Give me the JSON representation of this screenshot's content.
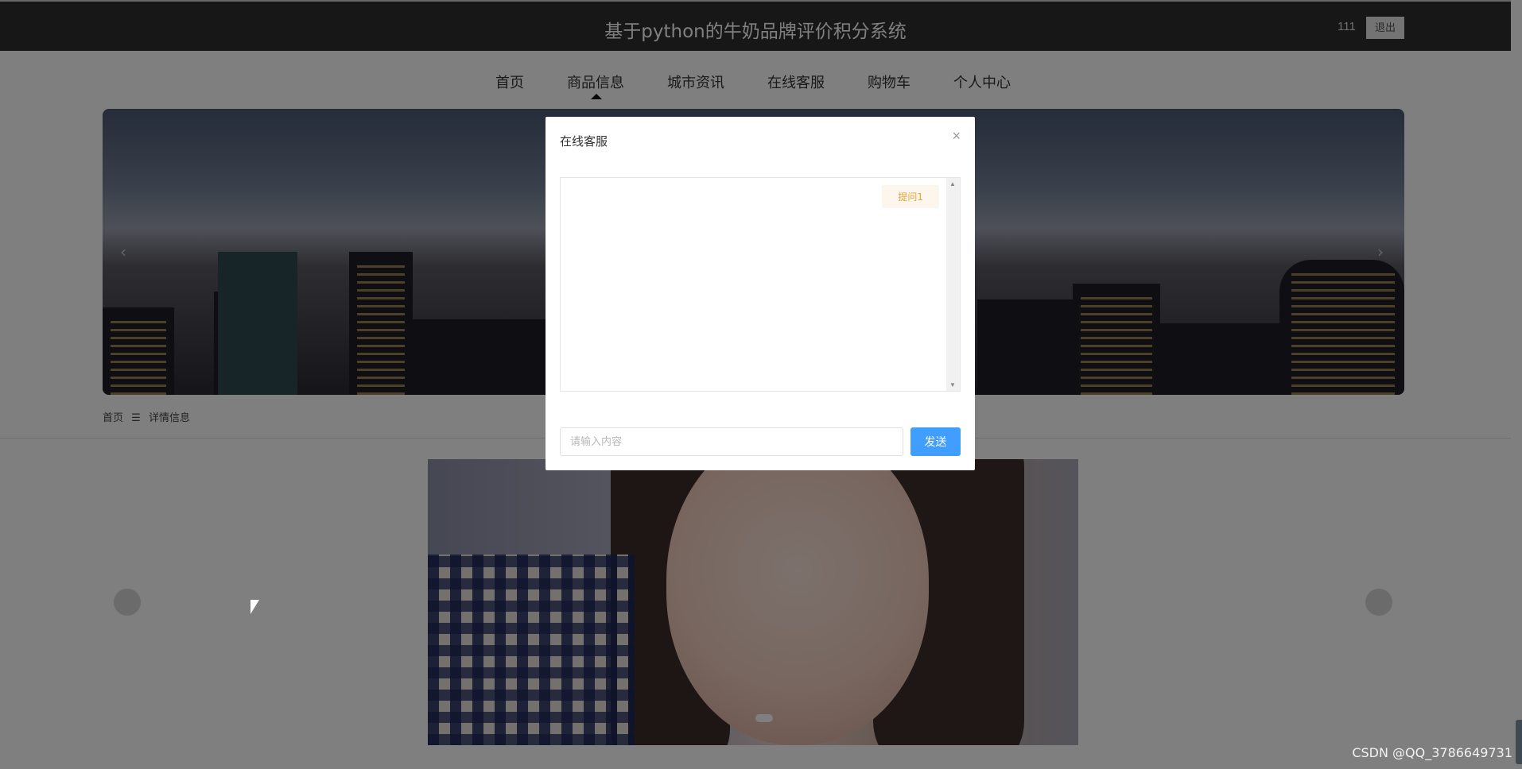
{
  "header": {
    "title": "基于python的牛奶品牌评价积分系统",
    "user": "111",
    "logout_label": "退出"
  },
  "nav": {
    "items": [
      {
        "label": "首页"
      },
      {
        "label": "商品信息"
      },
      {
        "label": "城市资讯"
      },
      {
        "label": "在线客服"
      },
      {
        "label": "购物车"
      },
      {
        "label": "个人中心"
      }
    ],
    "active_index": 1
  },
  "banner": {
    "prev_icon": "chevron-left-icon",
    "next_icon": "chevron-right-icon"
  },
  "breadcrumb": {
    "home": "首页",
    "separator": "☰",
    "current": "详情信息"
  },
  "modal": {
    "title": "在线客服",
    "close_icon": "close-icon",
    "messages": [
      {
        "text": "提问1",
        "side": "right"
      }
    ],
    "input_placeholder": "请输入内容",
    "input_value": "",
    "send_label": "发送"
  },
  "watermark": "CSDN @QQ_3786649731",
  "colors": {
    "topbar": "#2f2f2f",
    "primary": "#409eff",
    "message_bg": "#fdf6ec",
    "message_text": "#e6a23c"
  }
}
